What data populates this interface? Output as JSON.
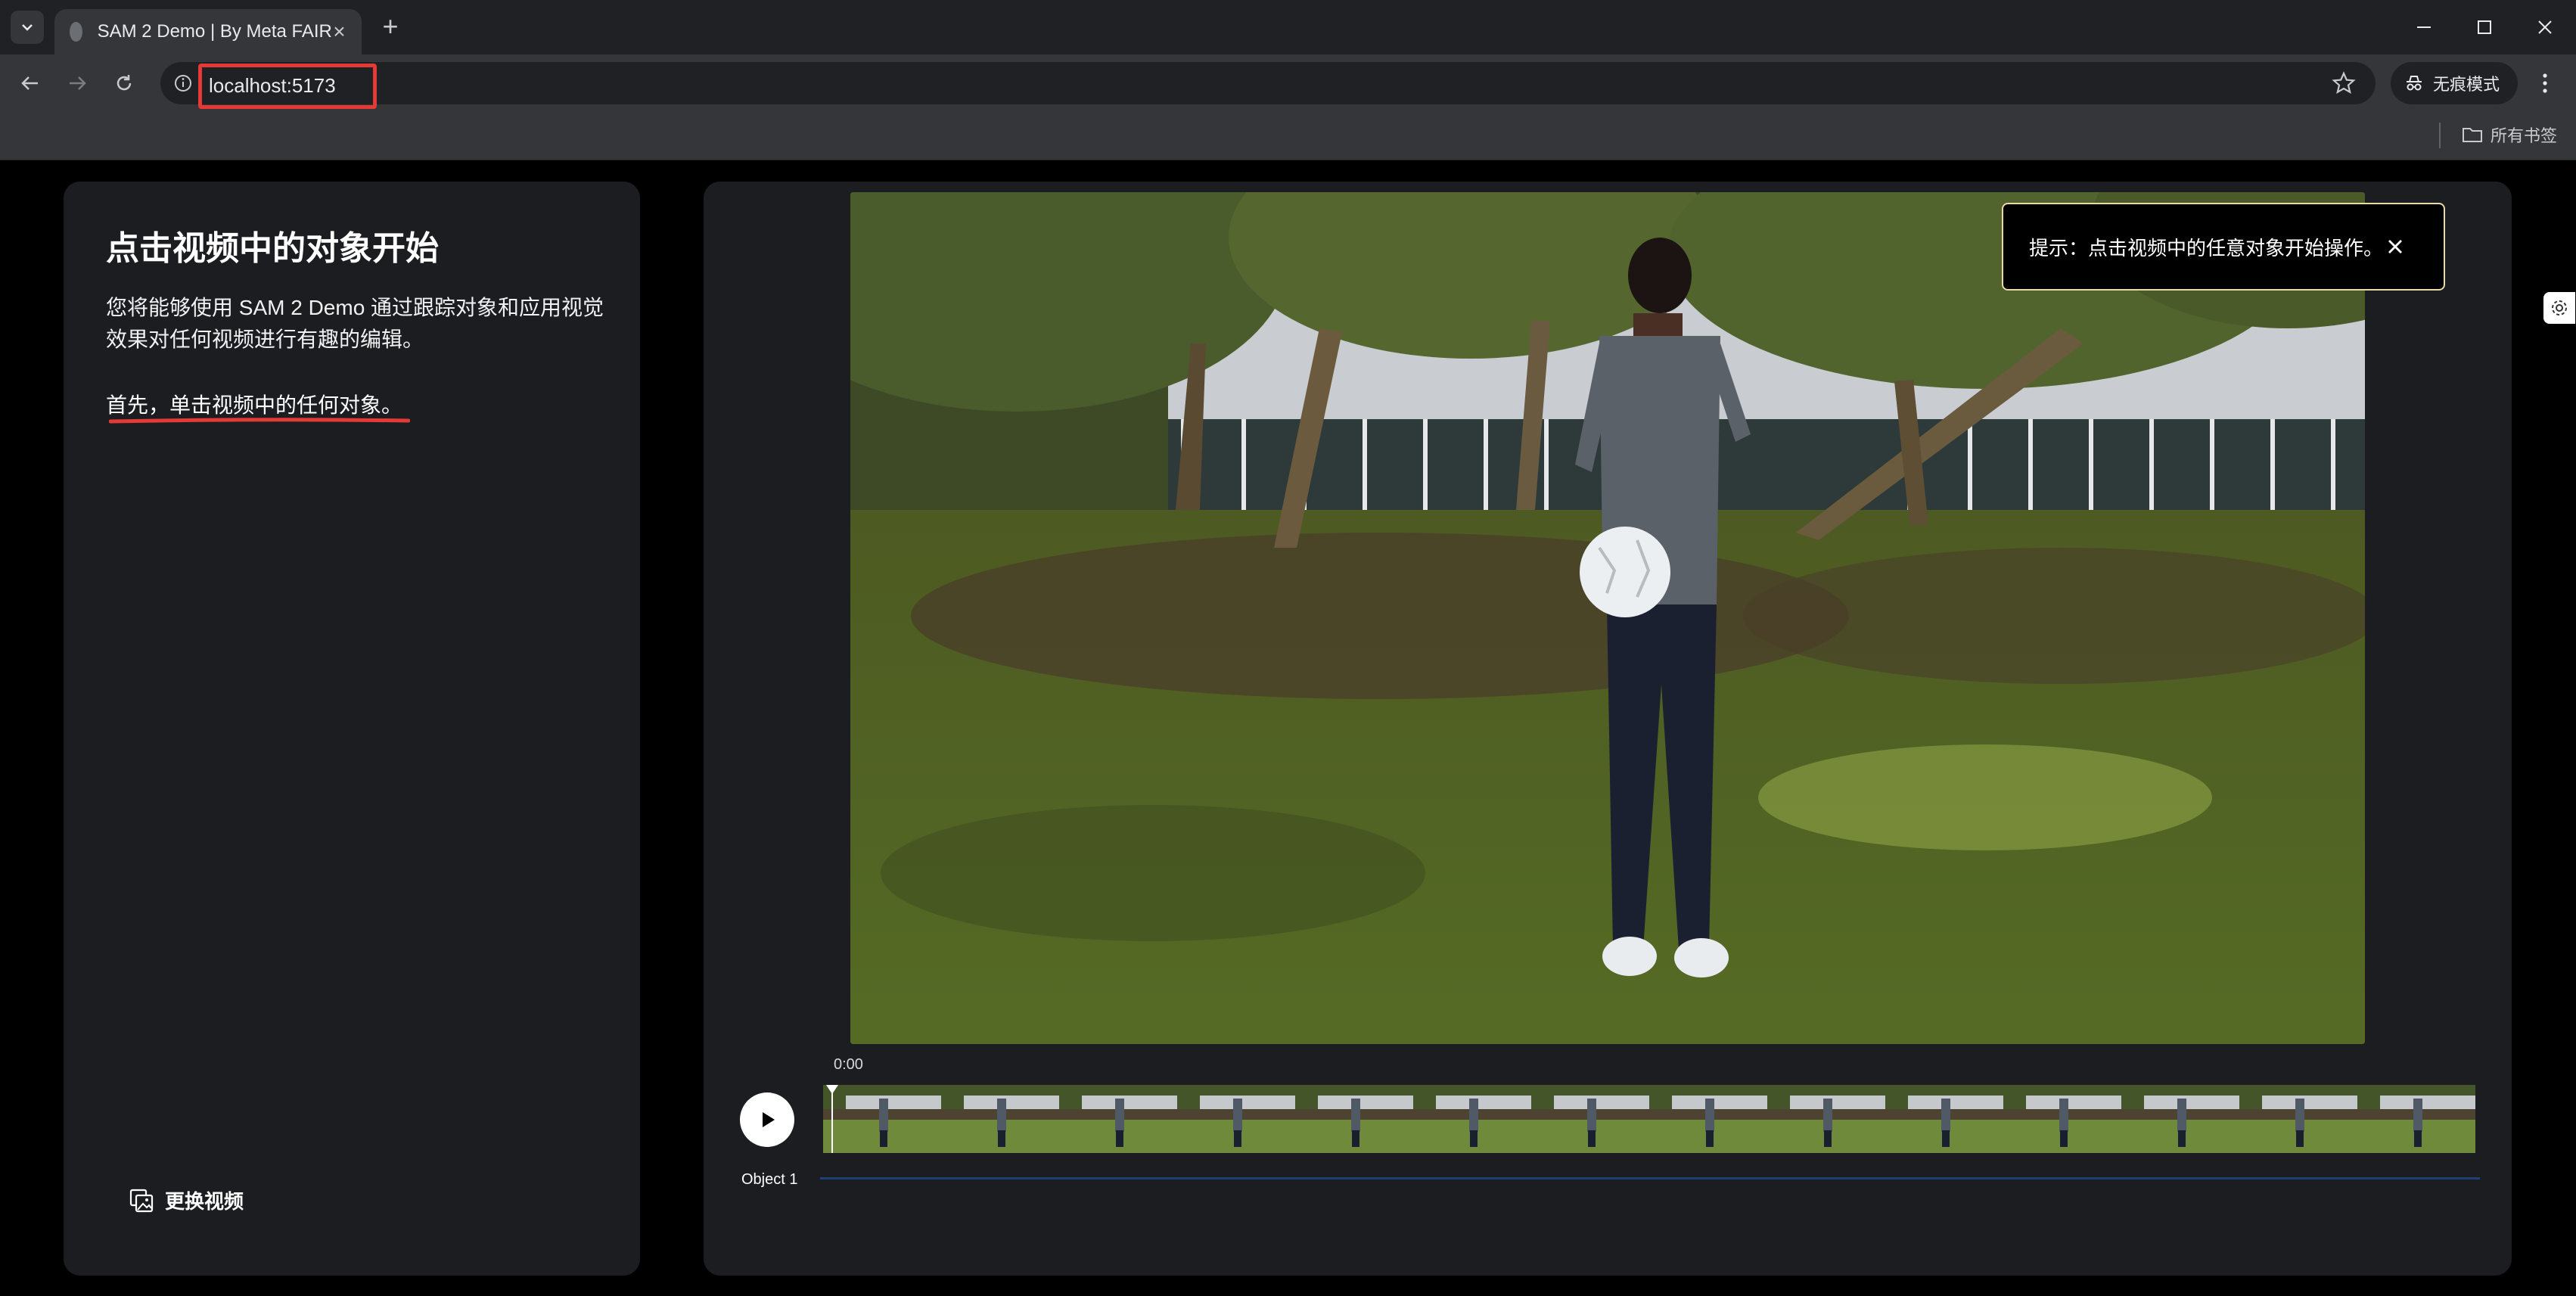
{
  "browser": {
    "tab_title": "SAM 2 Demo | By Meta FAIR",
    "url": "localhost:5173",
    "incognito_label": "无痕模式",
    "bookmarks_all_label": "所有书签"
  },
  "sidebar": {
    "title": "点击视频中的对象开始",
    "description": "您将能够使用 SAM 2 Demo 通过跟踪对象和应用视觉效果对任何视频进行有趣的编辑。",
    "step": "首先，单击视频中的任何对象。",
    "change_video_label": "更换视频"
  },
  "player": {
    "tooltip_text": "提示：点击视频中的任意对象开始操作。",
    "current_time": "0:00",
    "object_label": "Object 1"
  },
  "colors": {
    "highlight_red": "#e53935",
    "toast_border": "#e9d9a6",
    "track_blue": "#1e3f7a"
  },
  "icons": [
    "tab-menu-icon",
    "close-icon",
    "plus-icon",
    "minimize-icon",
    "maximize-icon",
    "back-icon",
    "forward-icon",
    "reload-icon",
    "info-icon",
    "star-icon",
    "incognito-icon",
    "kebab-icon",
    "folder-icon",
    "image-swap-icon",
    "play-icon",
    "settings-icon"
  ]
}
